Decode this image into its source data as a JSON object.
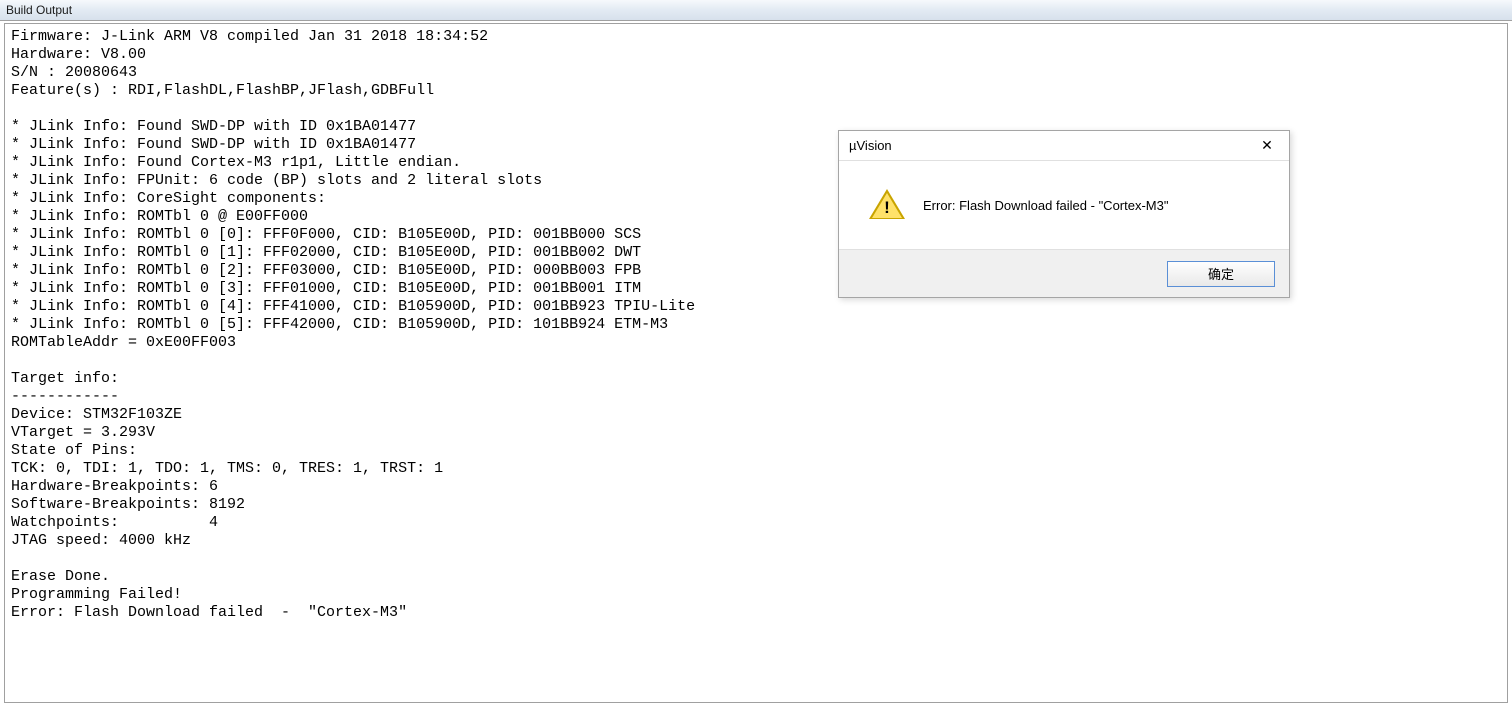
{
  "panel": {
    "title": "Build Output"
  },
  "output_lines": [
    "Firmware: J-Link ARM V8 compiled Jan 31 2018 18:34:52",
    "Hardware: V8.00",
    "S/N : 20080643",
    "Feature(s) : RDI,FlashDL,FlashBP,JFlash,GDBFull",
    "",
    "* JLink Info: Found SWD-DP with ID 0x1BA01477",
    "* JLink Info: Found SWD-DP with ID 0x1BA01477",
    "* JLink Info: Found Cortex-M3 r1p1, Little endian.",
    "* JLink Info: FPUnit: 6 code (BP) slots and 2 literal slots",
    "* JLink Info: CoreSight components:",
    "* JLink Info: ROMTbl 0 @ E00FF000",
    "* JLink Info: ROMTbl 0 [0]: FFF0F000, CID: B105E00D, PID: 001BB000 SCS",
    "* JLink Info: ROMTbl 0 [1]: FFF02000, CID: B105E00D, PID: 001BB002 DWT",
    "* JLink Info: ROMTbl 0 [2]: FFF03000, CID: B105E00D, PID: 000BB003 FPB",
    "* JLink Info: ROMTbl 0 [3]: FFF01000, CID: B105E00D, PID: 001BB001 ITM",
    "* JLink Info: ROMTbl 0 [4]: FFF41000, CID: B105900D, PID: 001BB923 TPIU-Lite",
    "* JLink Info: ROMTbl 0 [5]: FFF42000, CID: B105900D, PID: 101BB924 ETM-M3",
    "ROMTableAddr = 0xE00FF003",
    "",
    "Target info:",
    "------------",
    "Device: STM32F103ZE",
    "VTarget = 3.293V",
    "State of Pins:",
    "TCK: 0, TDI: 1, TDO: 1, TMS: 0, TRES: 1, TRST: 1",
    "Hardware-Breakpoints: 6",
    "Software-Breakpoints: 8192",
    "Watchpoints:          4",
    "JTAG speed: 4000 kHz",
    "",
    "Erase Done.",
    "Programming Failed!",
    "Error: Flash Download failed  -  \"Cortex-M3\""
  ],
  "dialog": {
    "title": "µVision",
    "message": "Error: Flash Download failed  -  \"Cortex-M3\"",
    "ok_label": "确定",
    "close_glyph": "✕",
    "bang": "!"
  }
}
